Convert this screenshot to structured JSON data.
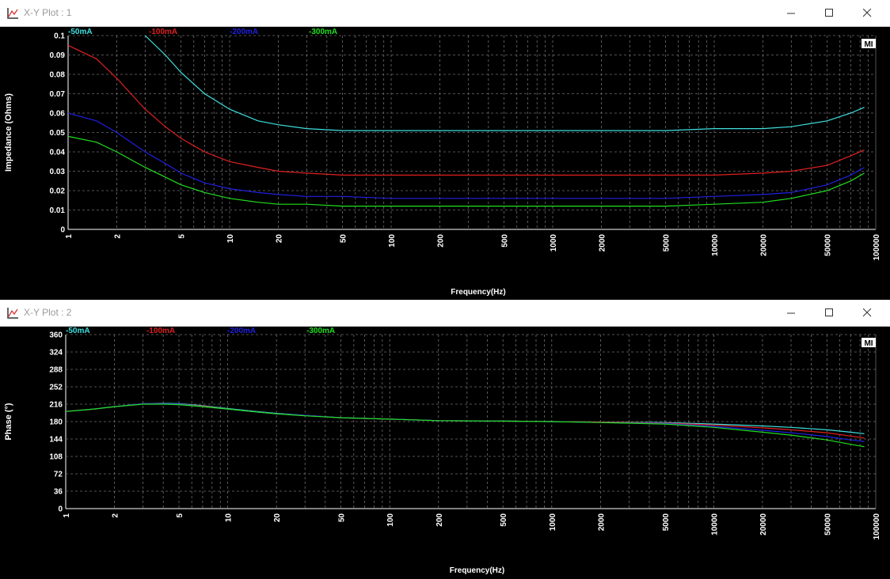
{
  "windows": [
    {
      "title": "X-Y Plot : 1",
      "badge": "MI",
      "controls": {
        "minimize": "minimize",
        "maximize": "maximize",
        "close": "close"
      }
    },
    {
      "title": "X-Y Plot : 2",
      "badge": "MI",
      "controls": {
        "minimize": "minimize",
        "maximize": "maximize",
        "close": "close"
      }
    }
  ],
  "icons": [
    "xy-plot-icon",
    "minimize-icon",
    "maximize-icon",
    "close-icon"
  ],
  "colors": {
    "background": "#000000",
    "grid": "#6e6e6e",
    "-50mA": "#40e0e0",
    "-100mA": "#e02020",
    "-200mA": "#2020e0",
    "-300mA": "#20e020"
  },
  "chart_data": [
    {
      "type": "line",
      "x_scale": "log",
      "xlabel": "Frequency(Hz)",
      "ylabel": "Impedance (Ohms)",
      "xlim": [
        1,
        100000
      ],
      "ylim": [
        0,
        0.1
      ],
      "x_ticks": [
        "1",
        "2",
        "5",
        "10",
        "20",
        "50",
        "100",
        "200",
        "500",
        "1000",
        "2000",
        "5000",
        "10000",
        "20000",
        "50000",
        "100000"
      ],
      "y_ticks": [
        "0",
        "0.01",
        "0.02",
        "0.03",
        "0.04",
        "0.05",
        "0.06",
        "0.07",
        "0.08",
        "0.09",
        "0.1"
      ],
      "grid": true,
      "legend": "top-left",
      "x": [
        1,
        1.5,
        2,
        3,
        4,
        5,
        7,
        10,
        15,
        20,
        30,
        50,
        100,
        200,
        500,
        1000,
        2000,
        5000,
        10000,
        20000,
        30000,
        50000,
        70000,
        85000
      ],
      "series": [
        {
          "name": "-50mA",
          "color": "#40e0e0",
          "values": [
            null,
            null,
            null,
            0.1,
            0.09,
            0.081,
            0.07,
            0.062,
            0.056,
            0.054,
            0.052,
            0.051,
            0.051,
            0.051,
            0.051,
            0.051,
            0.051,
            0.051,
            0.052,
            0.052,
            0.053,
            0.056,
            0.06,
            0.063
          ]
        },
        {
          "name": "-100mA",
          "color": "#e02020",
          "values": [
            0.095,
            0.088,
            0.078,
            0.062,
            0.053,
            0.047,
            0.04,
            0.035,
            0.032,
            0.03,
            0.029,
            0.028,
            0.028,
            0.028,
            0.028,
            0.028,
            0.028,
            0.028,
            0.028,
            0.029,
            0.03,
            0.033,
            0.038,
            0.041
          ]
        },
        {
          "name": "-200mA",
          "color": "#2020e0",
          "values": [
            0.06,
            0.056,
            0.05,
            0.04,
            0.034,
            0.029,
            0.024,
            0.021,
            0.019,
            0.018,
            0.017,
            0.017,
            0.016,
            0.016,
            0.016,
            0.016,
            0.016,
            0.016,
            0.017,
            0.018,
            0.019,
            0.023,
            0.028,
            0.032
          ]
        },
        {
          "name": "-300mA",
          "color": "#20e020",
          "values": [
            0.048,
            0.045,
            0.04,
            0.032,
            0.027,
            0.023,
            0.019,
            0.016,
            0.014,
            0.013,
            0.013,
            0.012,
            0.012,
            0.012,
            0.012,
            0.012,
            0.012,
            0.012,
            0.013,
            0.014,
            0.016,
            0.02,
            0.025,
            0.029
          ]
        }
      ]
    },
    {
      "type": "line",
      "x_scale": "log",
      "xlabel": "Frequency(Hz)",
      "ylabel": "Phase (°)",
      "xlim": [
        1,
        100000
      ],
      "ylim": [
        0,
        360
      ],
      "x_ticks": [
        "1",
        "2",
        "5",
        "10",
        "20",
        "50",
        "100",
        "200",
        "500",
        "1000",
        "2000",
        "5000",
        "10000",
        "20000",
        "50000",
        "100000"
      ],
      "y_ticks": [
        "0",
        "36",
        "72",
        "108",
        "144",
        "180",
        "216",
        "252",
        "288",
        "324",
        "360"
      ],
      "grid": true,
      "legend": "top-left",
      "x": [
        1,
        1.5,
        2,
        3,
        4,
        5,
        7,
        10,
        15,
        20,
        30,
        50,
        100,
        200,
        500,
        1000,
        2000,
        5000,
        10000,
        20000,
        30000,
        50000,
        70000,
        85000
      ],
      "series": [
        {
          "name": "-50mA",
          "color": "#40e0e0",
          "values": [
            201,
            206,
            211,
            217,
            218,
            217,
            213,
            207,
            201,
            197,
            193,
            188,
            185,
            182,
            181,
            180,
            179,
            178,
            175,
            171,
            168,
            163,
            158,
            155
          ]
        },
        {
          "name": "-100mA",
          "color": "#e02020",
          "values": [
            201,
            206,
            211,
            217,
            217,
            216,
            212,
            206,
            200,
            196,
            193,
            188,
            185,
            182,
            181,
            180,
            179,
            177,
            173,
            167,
            163,
            157,
            150,
            146
          ]
        },
        {
          "name": "-200mA",
          "color": "#2020e0",
          "values": [
            201,
            206,
            211,
            217,
            217,
            216,
            211,
            206,
            200,
            196,
            193,
            188,
            185,
            182,
            181,
            180,
            178,
            176,
            170,
            162,
            157,
            149,
            142,
            139
          ]
        },
        {
          "name": "-300mA",
          "color": "#20e020",
          "values": [
            201,
            206,
            211,
            216,
            216,
            215,
            211,
            206,
            200,
            196,
            192,
            188,
            185,
            182,
            181,
            180,
            178,
            175,
            168,
            158,
            152,
            142,
            133,
            128
          ]
        }
      ]
    }
  ]
}
